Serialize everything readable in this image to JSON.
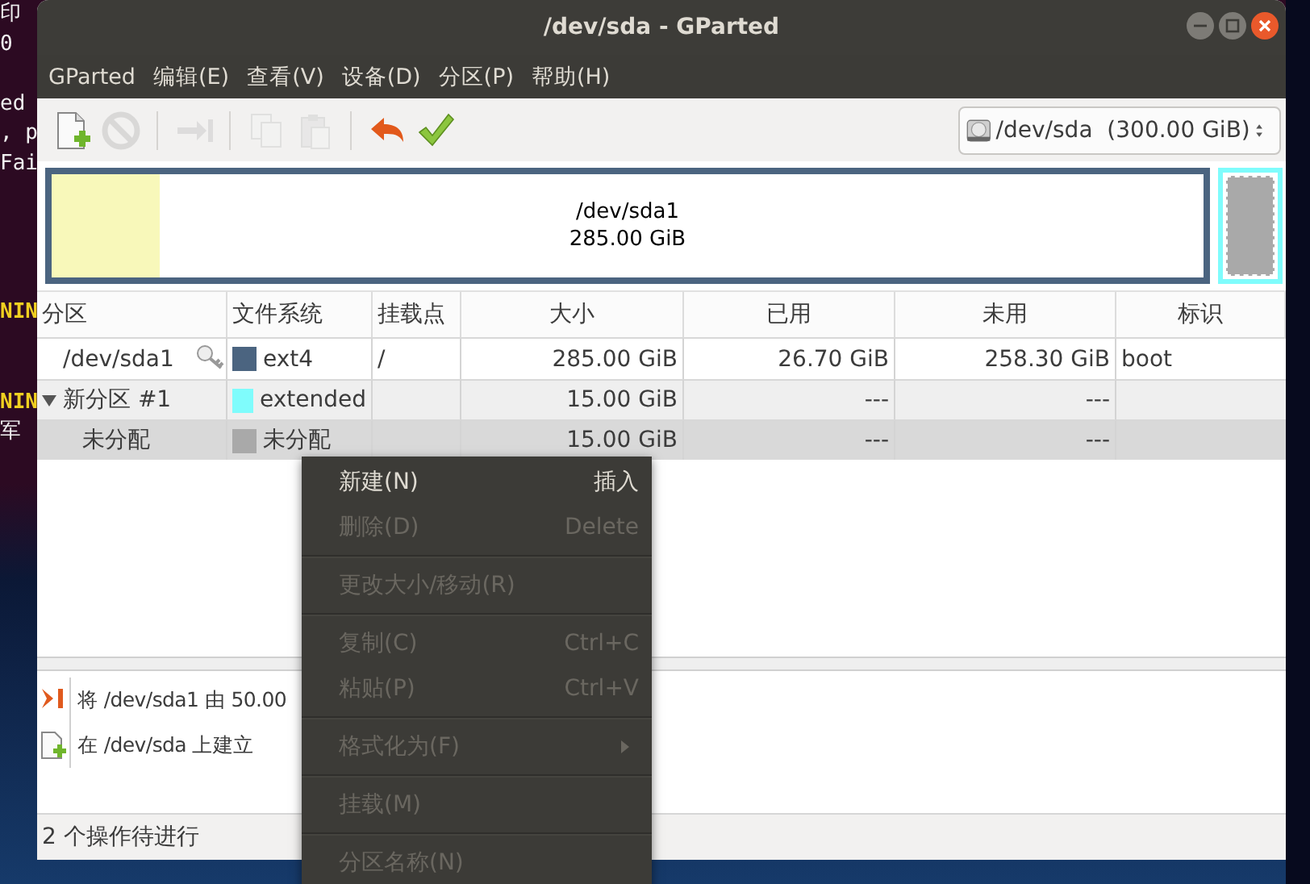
{
  "terminal": {
    "blocks": [
      [
        {
          "text": "印",
          "kind": "plain"
        },
        {
          "text": "0",
          "kind": "plain"
        }
      ],
      [
        {
          "text": "ed",
          "kind": "plain"
        },
        {
          "text": ", p",
          "kind": "plain"
        },
        {
          "text": "Fai",
          "kind": "plain"
        }
      ],
      [
        {
          "text": "NIN",
          "kind": "warn"
        }
      ],
      [
        {
          "text": "NIN",
          "kind": "warn"
        },
        {
          "text": "军",
          "kind": "plain"
        }
      ]
    ]
  },
  "window": {
    "title": "/dev/sda - GParted"
  },
  "menubar": [
    "GParted",
    "编辑(E)",
    "查看(V)",
    "设备(D)",
    "分区(P)",
    "帮助(H)"
  ],
  "toolbar": [
    {
      "kind": "new",
      "disabled": false
    },
    {
      "kind": "delete",
      "disabled": true
    },
    {
      "kind": "separator"
    },
    {
      "kind": "resize",
      "disabled": true
    },
    {
      "kind": "separator"
    },
    {
      "kind": "copy",
      "disabled": true
    },
    {
      "kind": "paste",
      "disabled": true
    },
    {
      "kind": "separator"
    },
    {
      "kind": "undo",
      "disabled": false
    },
    {
      "kind": "apply",
      "disabled": false
    }
  ],
  "device": {
    "name": "/dev/sda",
    "size": "(300.00 GiB)"
  },
  "graph": {
    "partitions": [
      {
        "kind": "primary",
        "name": "/dev/sda1",
        "size": "285.00 GiB",
        "level": 0.094,
        "color": "#4b6480",
        "selected": false
      },
      {
        "kind": "extended",
        "color": "#7ffcfc",
        "children": [
          {
            "kind": "unallocated",
            "color": "#a9a9a9",
            "selected": true
          }
        ]
      }
    ]
  },
  "table": {
    "columns": [
      "分区",
      "文件系统",
      "挂载点",
      "大小",
      "已用",
      "未用",
      "标识"
    ],
    "rows": [
      {
        "partition": "/dev/sda1",
        "locked": true,
        "color": "#4b6480",
        "filesystem": "ext4",
        "mountpoint": "/",
        "size": "285.00 GiB",
        "used": "26.70 GiB",
        "unused": "258.30 GiB",
        "flags": "boot",
        "selected": false
      },
      {
        "partition": "新分区 #1",
        "locked": false,
        "expanded": true,
        "color": "#7ffcfc",
        "filesystem": "extended",
        "size": "15.00 GiB",
        "used": "---",
        "unused": "---",
        "selected": false,
        "children": [
          {
            "partition": "未分配",
            "locked": false,
            "color": "#a9a9a9",
            "filesystem": "未分配",
            "size": "15.00 GiB",
            "used": "---",
            "unused": "---",
            "selected": true
          }
        ]
      }
    ]
  },
  "operations": [
    {
      "kind": "resize",
      "text": "将 /dev/sda1 由 50.00"
    },
    {
      "kind": "create",
      "text": "在 /dev/sda 上建立"
    }
  ],
  "status_bar": "2 个操作待进行",
  "context_menu": {
    "groups": [
      [
        {
          "label": "新建(N)",
          "shortcut": "插入",
          "disabled": false
        },
        {
          "label": "删除(D)",
          "shortcut": "Delete",
          "disabled": true
        }
      ],
      [
        {
          "label": "更改大小/移动(R)",
          "disabled": true
        }
      ],
      [
        {
          "label": "复制(C)",
          "shortcut": "Ctrl+C",
          "disabled": true
        },
        {
          "label": "粘贴(P)",
          "shortcut": "Ctrl+V",
          "disabled": true
        }
      ],
      [
        {
          "label": "格式化为(F)",
          "disabled": true,
          "submenu": true
        }
      ],
      [
        {
          "label": "挂载(M)",
          "disabled": true
        }
      ],
      [
        {
          "label": "分区名称(N)",
          "disabled": true
        }
      ]
    ]
  }
}
